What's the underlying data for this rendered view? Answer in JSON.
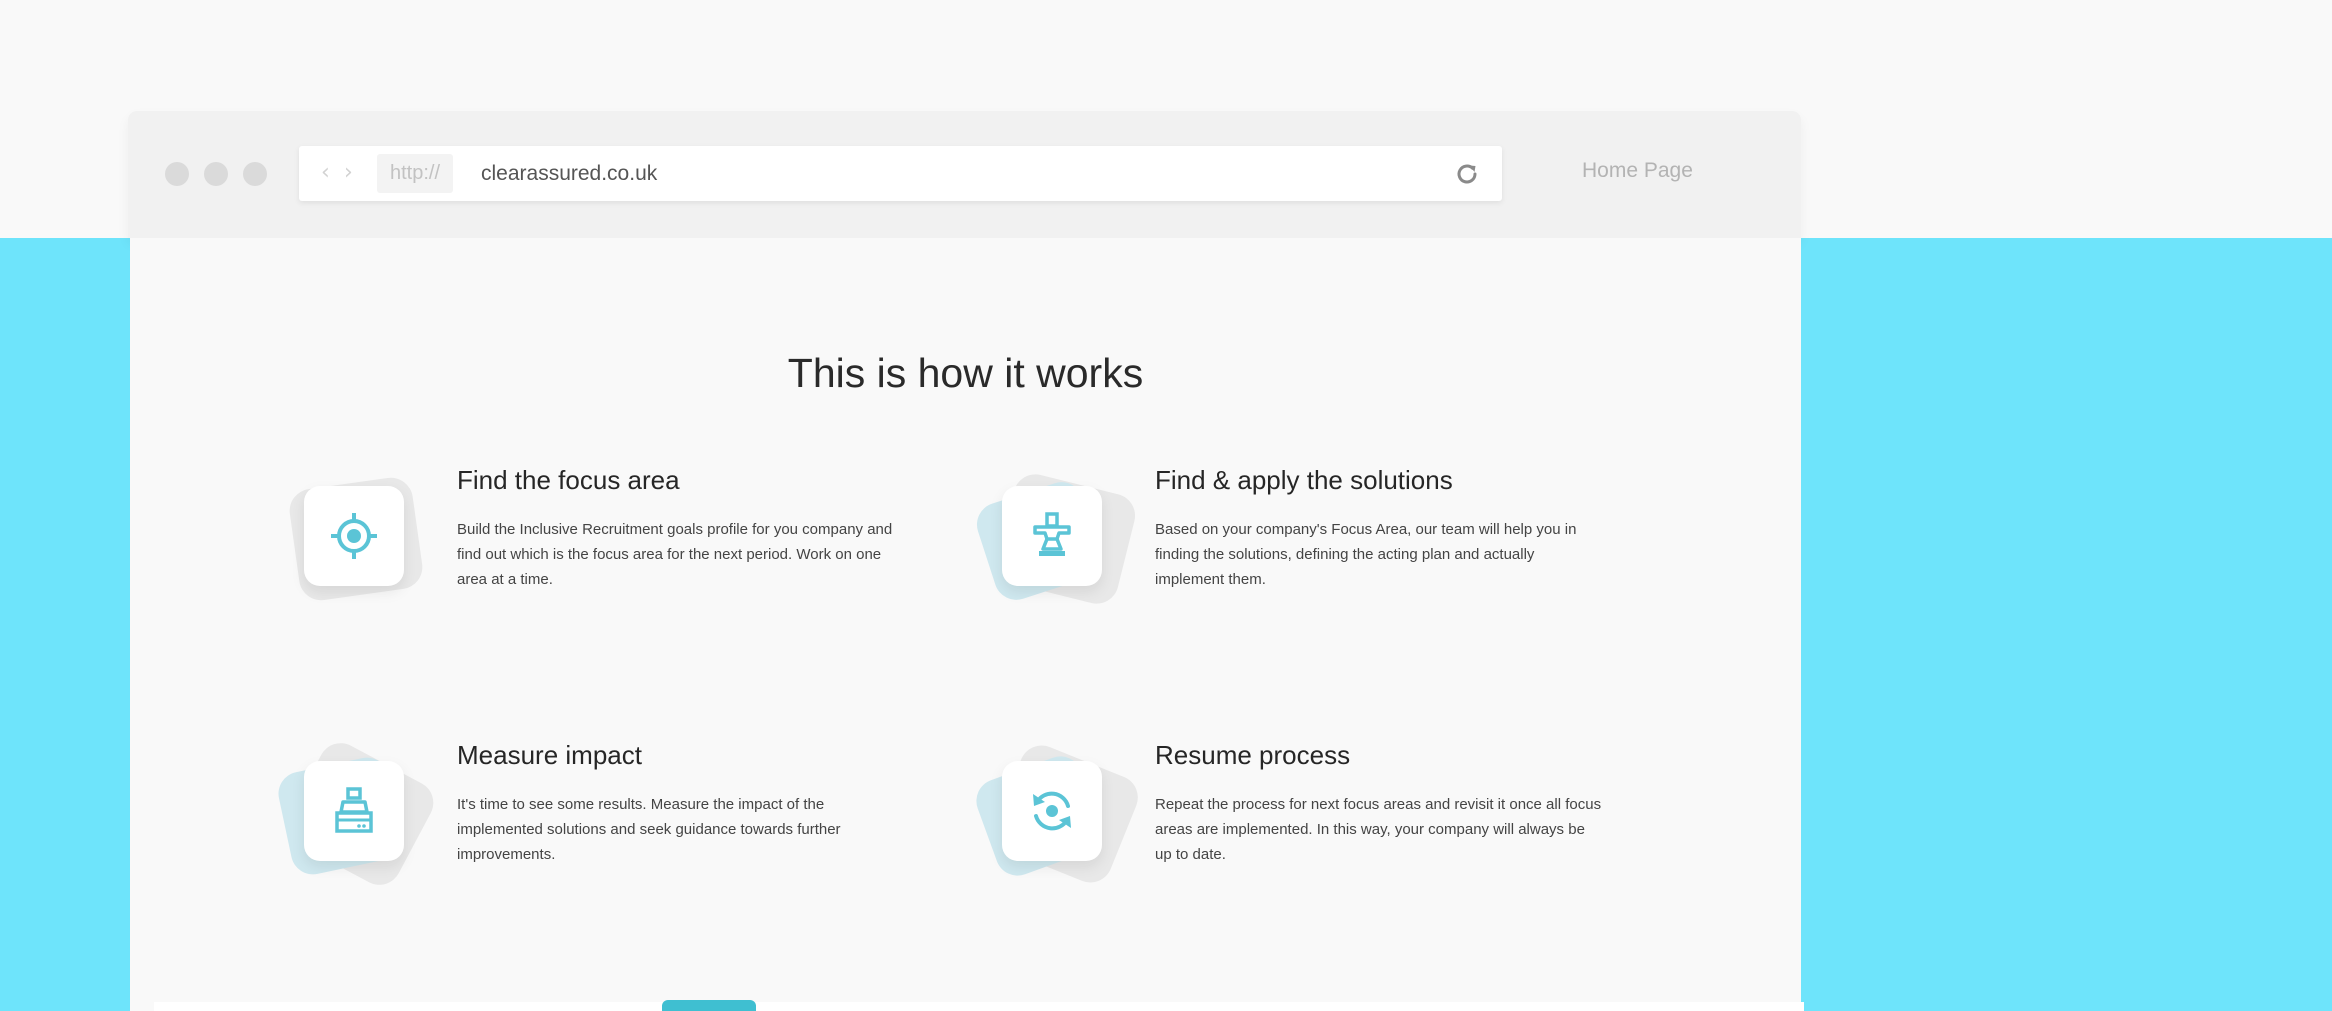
{
  "browser": {
    "url_prefix": "http://",
    "url": "clearassured.co.uk",
    "home_link": "Home Page",
    "icons": [
      "back-icon",
      "forward-icon",
      "reload-icon"
    ]
  },
  "page": {
    "title": "This is how it works",
    "features": [
      {
        "title": "Find the focus area",
        "description": "Build the Inclusive Recruitment goals profile for you company and find out which is the focus area for the next period. Work on one area at a time.",
        "icon": "target-icon"
      },
      {
        "title": "Find & apply the solutions",
        "description": "Based on  your company's  Focus Area, our team will help you in finding the solutions, defining the acting plan and actually implement them.",
        "icon": "anvil-icon"
      },
      {
        "title": "Measure impact",
        "description": "It's time to see some results. Measure the impact of the implemented solutions and seek guidance towards further improvements.",
        "icon": "cash-register-icon"
      },
      {
        "title": "Resume process",
        "description": "Repeat the process for next focus areas and revisit it once all focus areas are implemented. In this way, your company will always be up to date.",
        "icon": "refresh-icon"
      }
    ]
  },
  "colors": {
    "accent": "#5bc4d6",
    "background_band": "#6ee4fb",
    "page_background": "#f9f9f9"
  }
}
